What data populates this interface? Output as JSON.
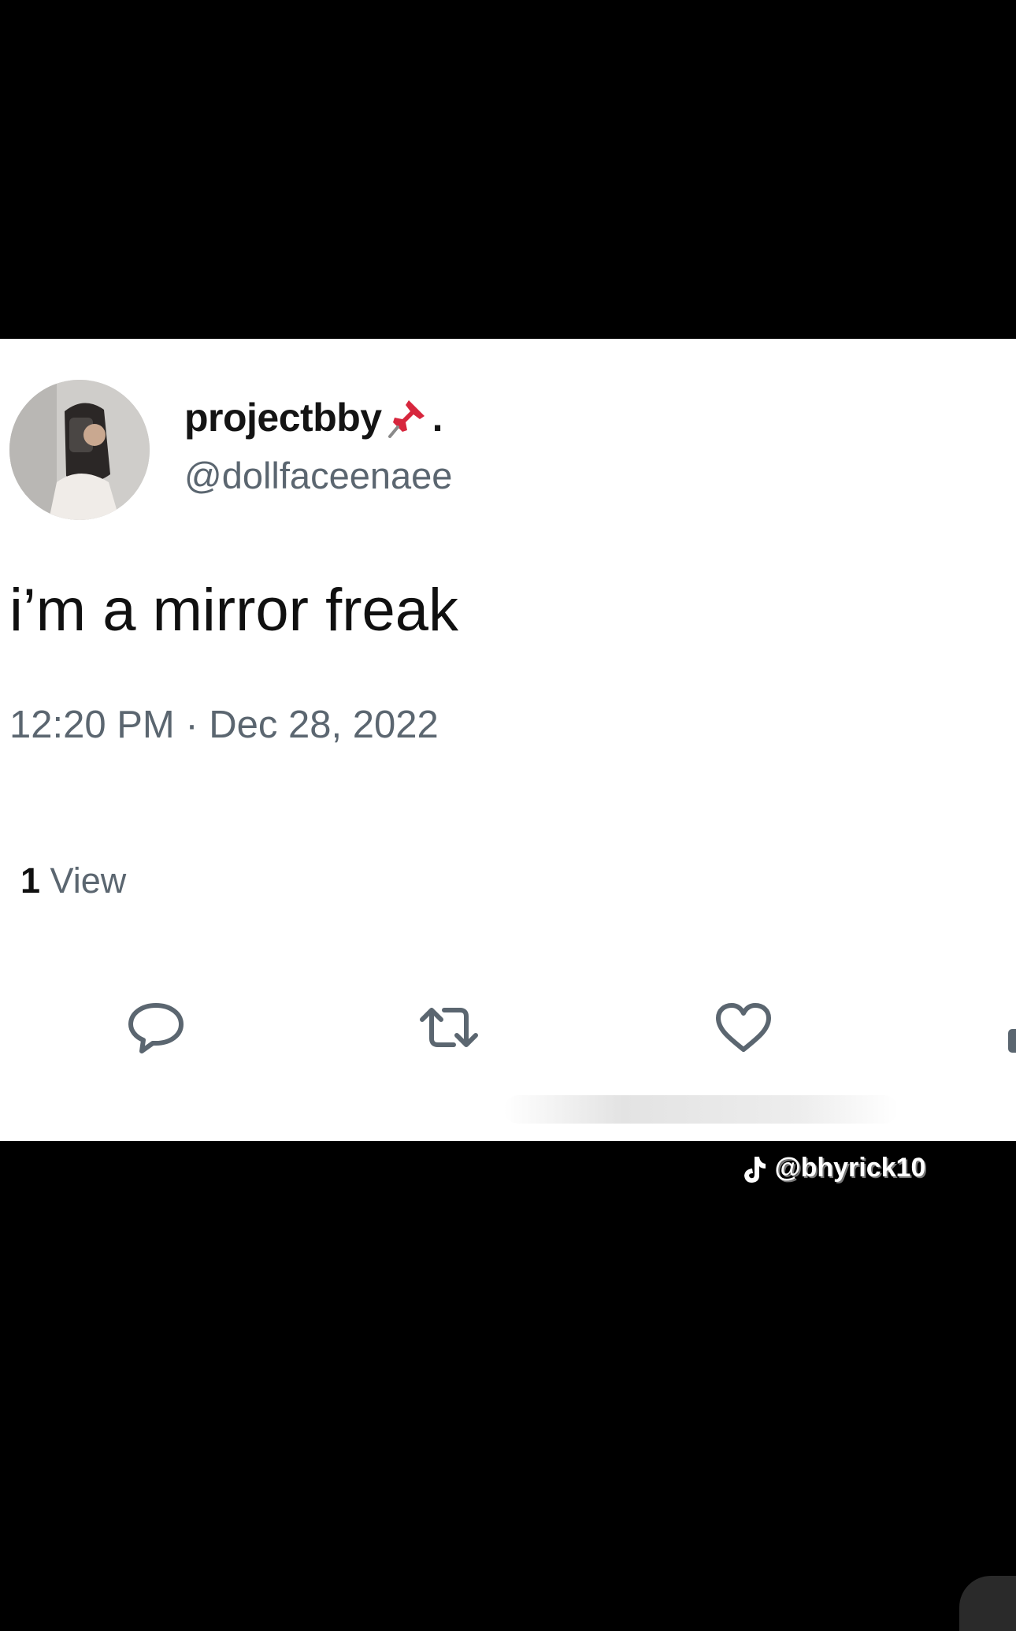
{
  "tweet": {
    "display_name": "projectbby",
    "name_suffix": ".",
    "handle": "@dollfaceenaee",
    "text": "i’m a mirror freak",
    "timestamp": "12:20 PM · Dec 28, 2022",
    "views_count": "1",
    "views_label": "View"
  },
  "icons": {
    "name_emoji": "pushpin-icon",
    "reply": "reply-bubble-icon",
    "retweet": "retweet-icon",
    "like": "heart-icon",
    "share": "share-icon"
  },
  "watermark": {
    "text": "@bhyrick10"
  },
  "colors": {
    "background": "#000000",
    "card": "#ffffff",
    "primary_text": "#101010",
    "secondary_text": "#5b6670",
    "pin_red": "#d7263d"
  }
}
